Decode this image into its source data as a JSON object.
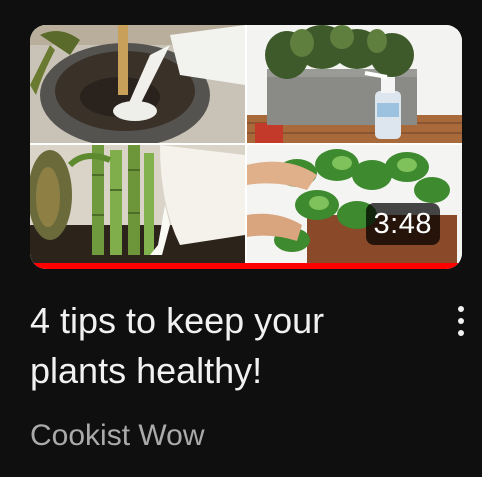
{
  "video": {
    "title": "4 tips to keep your plants healthy!",
    "channel": "Cookist Wow",
    "duration": "3:48",
    "watch_progress_fraction": 1.0
  },
  "thumbnail": {
    "description_panels": [
      "watering-pot",
      "rosemary-planter",
      "lucky-bamboo-milk",
      "pothos-plant"
    ]
  },
  "icons": {
    "menu": "more-vert-icon"
  },
  "colors": {
    "background": "#0f0f0f",
    "title": "#f1f1f1",
    "channel": "#aaaaaa",
    "progress": "#ff0000"
  }
}
